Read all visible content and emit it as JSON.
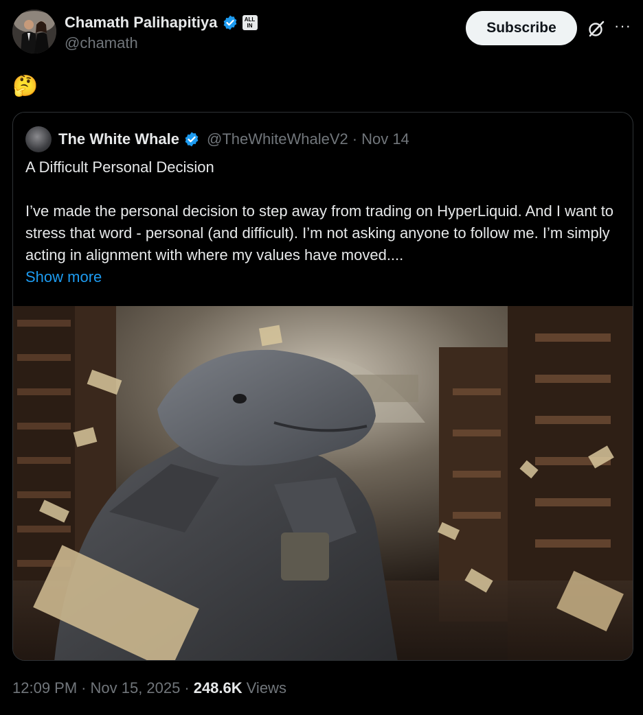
{
  "author": {
    "name": "Chamath Palihapitiya",
    "handle": "@chamath",
    "affiliation_badge": "ALL IN",
    "avatar_icon": "profile-photo"
  },
  "actions": {
    "subscribe_label": "Subscribe",
    "grok_icon": "grok-icon",
    "more_icon": "more-icon"
  },
  "tweet": {
    "text": "🤔"
  },
  "quote": {
    "author_name": "The White Whale",
    "handle": "@TheWhiteWhaleV2",
    "separator": "·",
    "date": "Nov 14",
    "title": "A Difficult Personal Decision",
    "body": "I’ve made the personal decision to step away from trading on HyperLiquid. And I want to stress that word - personal (and difficult). I’m not asking anyone to follow me. I’m simply acting in alignment with where my values have moved....",
    "show_more": "Show more",
    "image_icon": "whale-in-armor-library-image"
  },
  "meta": {
    "time": "12:09 PM",
    "sep1": "·",
    "date": "Nov 15, 2025",
    "sep2": "·",
    "views_count": "248.6K",
    "views_label": "Views"
  },
  "colors": {
    "background": "#000000",
    "text": "#e7e9ea",
    "muted": "#71767b",
    "accent": "#1d9bf0",
    "border": "#2f3336"
  }
}
